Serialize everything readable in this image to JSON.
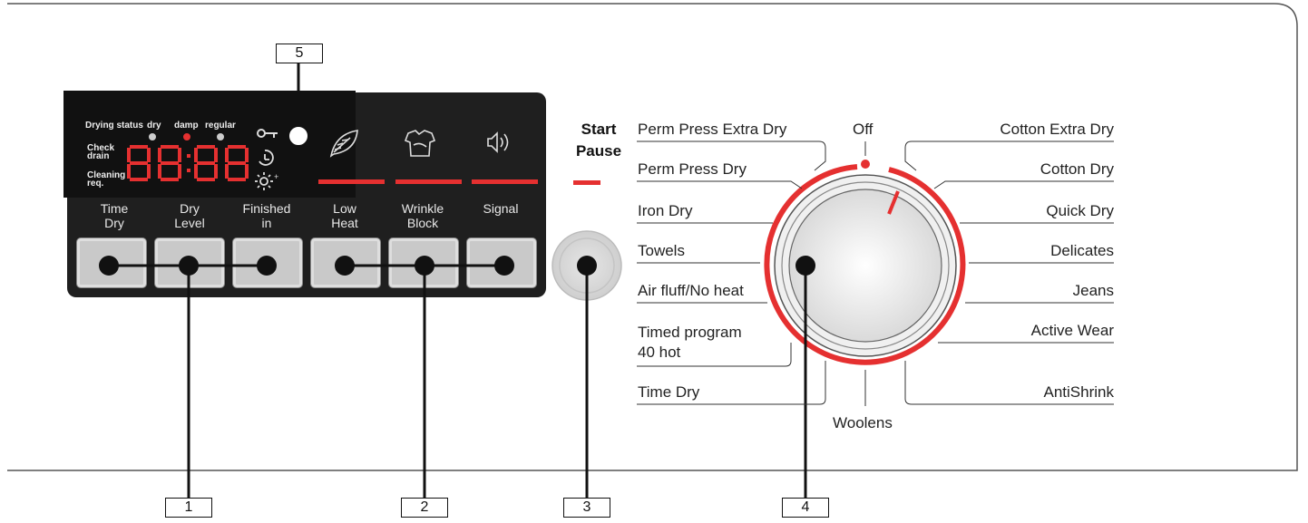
{
  "callouts": [
    "1",
    "2",
    "3",
    "4",
    "5"
  ],
  "display": {
    "drying_status": "Drying status",
    "status_dry": "dry",
    "status_damp": "damp",
    "status_regular": "regular",
    "check_drain_1": "Check",
    "check_drain_2": "drain",
    "cleaning_1": "Cleaning",
    "cleaning_2": "req.",
    "digits": "88:88"
  },
  "buttons": [
    {
      "line1": "Time",
      "line2": "Dry"
    },
    {
      "line1": "Dry",
      "line2": "Level"
    },
    {
      "line1": "Finished",
      "line2": "in"
    },
    {
      "line1": "Low",
      "line2": "Heat"
    },
    {
      "line1": "Wrinkle",
      "line2": "Block"
    },
    {
      "line1": "Signal",
      "line2": ""
    }
  ],
  "icons": [
    "key-icon",
    "leaf-icon",
    "shirt-icon",
    "speaker-icon",
    "clock-icon",
    "sun-icon"
  ],
  "start_pause": {
    "line1": "Start",
    "line2": "Pause"
  },
  "programs_left": [
    "Perm Press Extra Dry",
    "Perm Press Dry",
    "Iron Dry",
    "Towels",
    "Air fluff/No heat",
    "Timed program",
    "40 hot",
    "Time Dry"
  ],
  "programs_top": "Off",
  "programs_bottom": "Woolens",
  "programs_right": [
    "Cotton Extra Dry",
    "Cotton Dry",
    "Quick Dry",
    "Delicates",
    "Jeans",
    "Active Wear",
    "AntiShrink"
  ],
  "colors": {
    "accent_red": "#e53030",
    "panel_dark": "#1f1f1f",
    "button_grey": "#c9c9c9"
  }
}
